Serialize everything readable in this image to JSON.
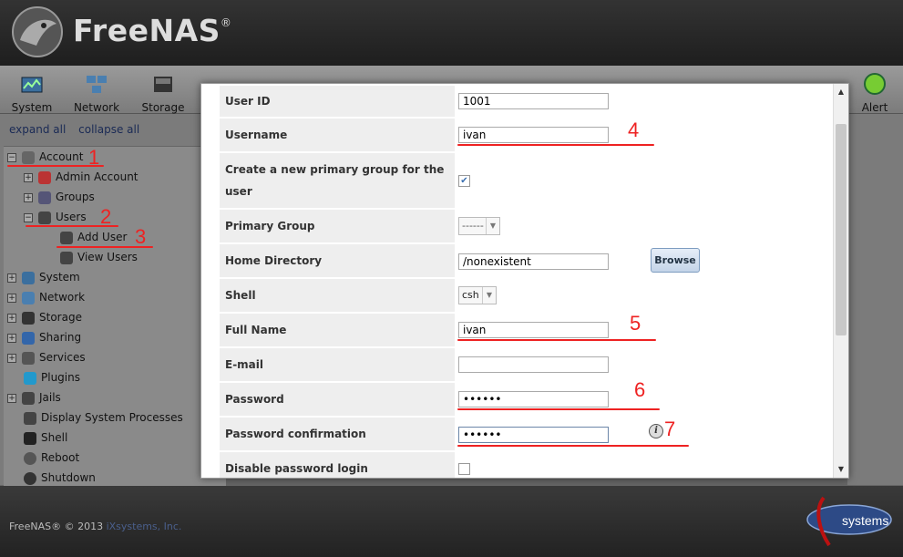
{
  "brand": {
    "name": "FreeNAS",
    "mark": "®"
  },
  "toolbar": {
    "items": [
      {
        "label": "System",
        "icon": "system-icon"
      },
      {
        "label": "Network",
        "icon": "network-icon"
      },
      {
        "label": "Storage",
        "icon": "storage-icon"
      },
      {
        "label": "Alert",
        "icon": "alert-icon"
      }
    ]
  },
  "sidebar": {
    "expand_all": "expand all",
    "collapse_all": "collapse all",
    "tree": [
      {
        "label": "Account",
        "icon": "account-icon"
      },
      {
        "label": "Admin Account",
        "icon": "admin-account-icon"
      },
      {
        "label": "Groups",
        "icon": "groups-icon"
      },
      {
        "label": "Users",
        "icon": "users-icon"
      },
      {
        "label": "Add User",
        "icon": "add-user-icon"
      },
      {
        "label": "View Users",
        "icon": "view-users-icon"
      },
      {
        "label": "System",
        "icon": "system-icon"
      },
      {
        "label": "Network",
        "icon": "network-icon"
      },
      {
        "label": "Storage",
        "icon": "storage-icon"
      },
      {
        "label": "Sharing",
        "icon": "sharing-icon"
      },
      {
        "label": "Services",
        "icon": "services-icon"
      },
      {
        "label": "Plugins",
        "icon": "plugins-icon"
      },
      {
        "label": "Jails",
        "icon": "jails-icon"
      },
      {
        "label": "Display System Processes",
        "icon": "processes-icon"
      },
      {
        "label": "Shell",
        "icon": "shell-icon"
      },
      {
        "label": "Reboot",
        "icon": "reboot-icon"
      },
      {
        "label": "Shutdown",
        "icon": "shutdown-icon"
      }
    ]
  },
  "form": {
    "user_id": {
      "label": "User ID",
      "value": "1001"
    },
    "username": {
      "label": "Username",
      "value": "ivan"
    },
    "primary_group_new": {
      "label": "Create a new primary group for the user",
      "checked": true
    },
    "primary_group": {
      "label": "Primary Group",
      "value": "------"
    },
    "home_dir": {
      "label": "Home Directory",
      "value": "/nonexistent",
      "browse": "Browse"
    },
    "shell": {
      "label": "Shell",
      "value": "csh"
    },
    "full_name": {
      "label": "Full Name",
      "value": "ivan"
    },
    "email": {
      "label": "E-mail",
      "value": ""
    },
    "password": {
      "label": "Password",
      "value": "••••••"
    },
    "password_confirm": {
      "label": "Password confirmation",
      "value": "••••••"
    },
    "disable_password": {
      "label": "Disable password login",
      "checked": false
    }
  },
  "annotations": [
    "1",
    "2",
    "3",
    "4",
    "5",
    "6",
    "7"
  ],
  "footer": {
    "copyright": "FreeNAS® © 2013 ",
    "company": "iXsystems, Inc.",
    "logo_text": "systems"
  },
  "colors": {
    "annotation": "#e22222",
    "header": "#2a2a2a",
    "link": "#1a2a55"
  }
}
